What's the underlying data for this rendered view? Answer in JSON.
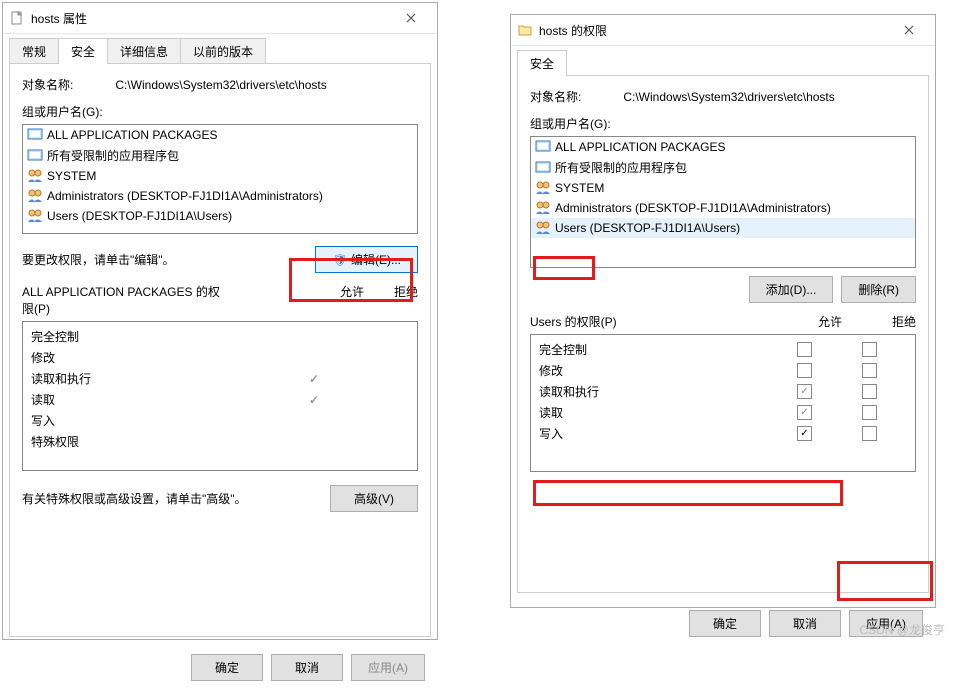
{
  "left": {
    "window_title": "hosts 属性",
    "tabs": [
      "常规",
      "安全",
      "详细信息",
      "以前的版本"
    ],
    "active_tab": 1,
    "object_name_label": "对象名称:",
    "object_name_value": "C:\\Windows\\System32\\drivers\\etc\\hosts",
    "group_label": "组或用户名(G):",
    "groups": [
      "ALL APPLICATION PACKAGES",
      "所有受限制的应用程序包",
      "SYSTEM",
      "Administrators (DESKTOP-FJ1DI1A\\Administrators)",
      "Users (DESKTOP-FJ1DI1A\\Users)"
    ],
    "edit_hint": "要更改权限，请单击\"编辑\"。",
    "edit_button": "编辑(E)...",
    "perm_header_left": "ALL APPLICATION PACKAGES 的权限(P)",
    "perm_allow": "允许",
    "perm_deny": "拒绝",
    "perms": [
      {
        "name": "完全控制",
        "allow": false,
        "deny": false
      },
      {
        "name": "修改",
        "allow": false,
        "deny": false
      },
      {
        "name": "读取和执行",
        "allow": true,
        "deny": false
      },
      {
        "name": "读取",
        "allow": true,
        "deny": false
      },
      {
        "name": "写入",
        "allow": false,
        "deny": false
      },
      {
        "name": "特殊权限",
        "allow": false,
        "deny": false
      }
    ],
    "advanced_hint": "有关特殊权限或高级设置，请单击\"高级\"。",
    "advanced_button": "高级(V)",
    "ok": "确定",
    "cancel": "取消",
    "apply": "应用(A)"
  },
  "right": {
    "window_title": "hosts 的权限",
    "tab": "安全",
    "object_name_label": "对象名称:",
    "object_name_value": "C:\\Windows\\System32\\drivers\\etc\\hosts",
    "group_label": "组或用户名(G):",
    "groups": [
      "ALL APPLICATION PACKAGES",
      "所有受限制的应用程序包",
      "SYSTEM",
      "Administrators (DESKTOP-FJ1DI1A\\Administrators)",
      "Users (DESKTOP-FJ1DI1A\\Users)"
    ],
    "selected_group_index": 4,
    "add_button": "添加(D)...",
    "remove_button": "删除(R)",
    "perm_header_left": "Users 的权限(P)",
    "perm_allow": "允许",
    "perm_deny": "拒绝",
    "perms": [
      {
        "name": "完全控制",
        "allow": false,
        "allow_gray": false,
        "deny": false
      },
      {
        "name": "修改",
        "allow": false,
        "allow_gray": false,
        "deny": false
      },
      {
        "name": "读取和执行",
        "allow": true,
        "allow_gray": true,
        "deny": false
      },
      {
        "name": "读取",
        "allow": true,
        "allow_gray": true,
        "deny": false
      },
      {
        "name": "写入",
        "allow": true,
        "allow_gray": false,
        "deny": false
      }
    ],
    "ok": "确定",
    "cancel": "取消",
    "apply": "应用(A)"
  },
  "footer": "CSDN @龙俊亨"
}
